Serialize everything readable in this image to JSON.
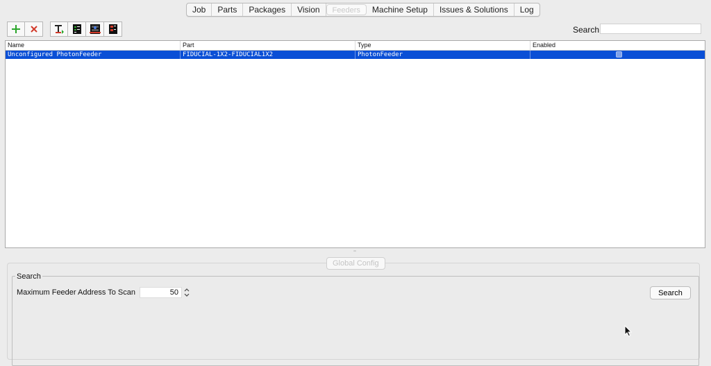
{
  "tabs": [
    "Job",
    "Parts",
    "Packages",
    "Vision",
    "Feeders",
    "Machine Setup",
    "Issues & Solutions",
    "Log"
  ],
  "selected_tab": "Feeders",
  "toolbar": {
    "buttons": [
      "add-icon",
      "delete-icon",
      "pick-icon",
      "feed-icon",
      "move-camera-icon",
      "move-tool-icon"
    ]
  },
  "search": {
    "label": "Search",
    "value": ""
  },
  "table": {
    "columns": [
      "Name",
      "Part",
      "Type",
      "Enabled"
    ],
    "rows": [
      {
        "name": "Unconfigured PhotonFeeder",
        "part": "FIDUCIAL-1X2-FIDUCIAL1X2",
        "type": "PhotonFeeder",
        "enabled": true
      }
    ]
  },
  "lower": {
    "tab_label": "Global Config",
    "group_title": "Search",
    "field_label": "Maximum Feeder Address To Scan",
    "field_value": "50",
    "button_label": "Search"
  },
  "colors": {
    "selection": "#0a4fd6",
    "accent_green": "#2aa52a",
    "accent_red": "#d23a2a"
  }
}
